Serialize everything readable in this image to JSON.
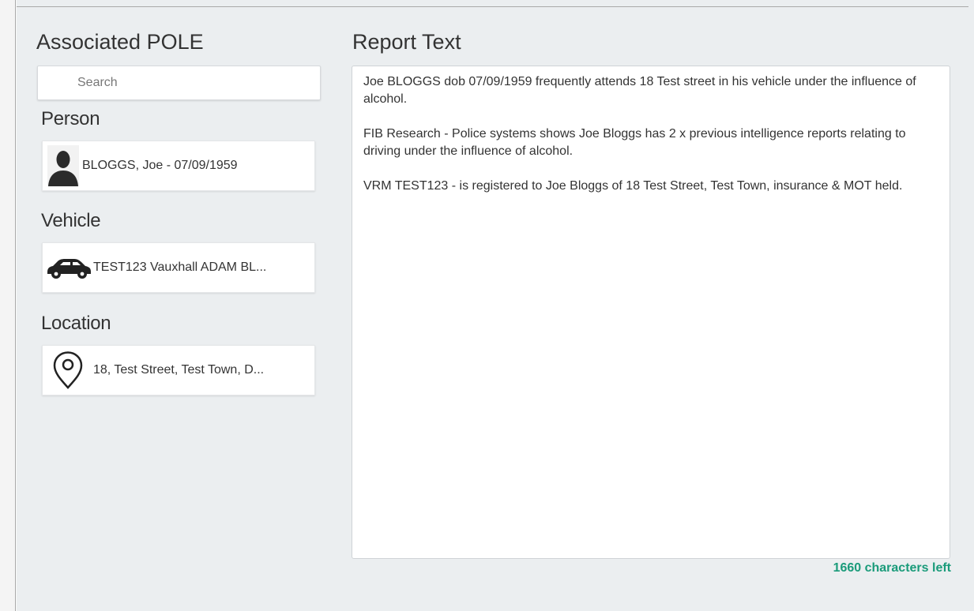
{
  "left_section": {
    "title": "Associated POLE",
    "search": {
      "placeholder": "Search",
      "value": ""
    }
  },
  "categories": {
    "person": {
      "heading": "Person",
      "item": {
        "label": "BLOGGS, Joe - 07/09/1959",
        "icon": "person-avatar-icon"
      }
    },
    "vehicle": {
      "heading": "Vehicle",
      "item": {
        "label": "TEST123 Vauxhall ADAM BL...",
        "icon": "car-icon"
      }
    },
    "location": {
      "heading": "Location",
      "item": {
        "label": "18, Test Street, Test Town, D...",
        "icon": "map-pin-icon"
      }
    }
  },
  "report": {
    "title": "Report Text",
    "text": "Joe BLOGGS dob 07/09/1959 frequently attends 18 Test street in his vehicle under the influence of alcohol.\n\nFIB Research - Police systems shows Joe Bloggs has 2 x previous intelligence reports relating to driving under the influence of alcohol.\n\nVRM TEST123 - is registered to Joe Bloggs of 18 Test Street, Test Town, insurance & MOT held.",
    "chars_left": "1660 characters left"
  },
  "colors": {
    "panel_bg": "#ebeef0",
    "chars_left": "#1a9b7a",
    "text": "#333333"
  }
}
